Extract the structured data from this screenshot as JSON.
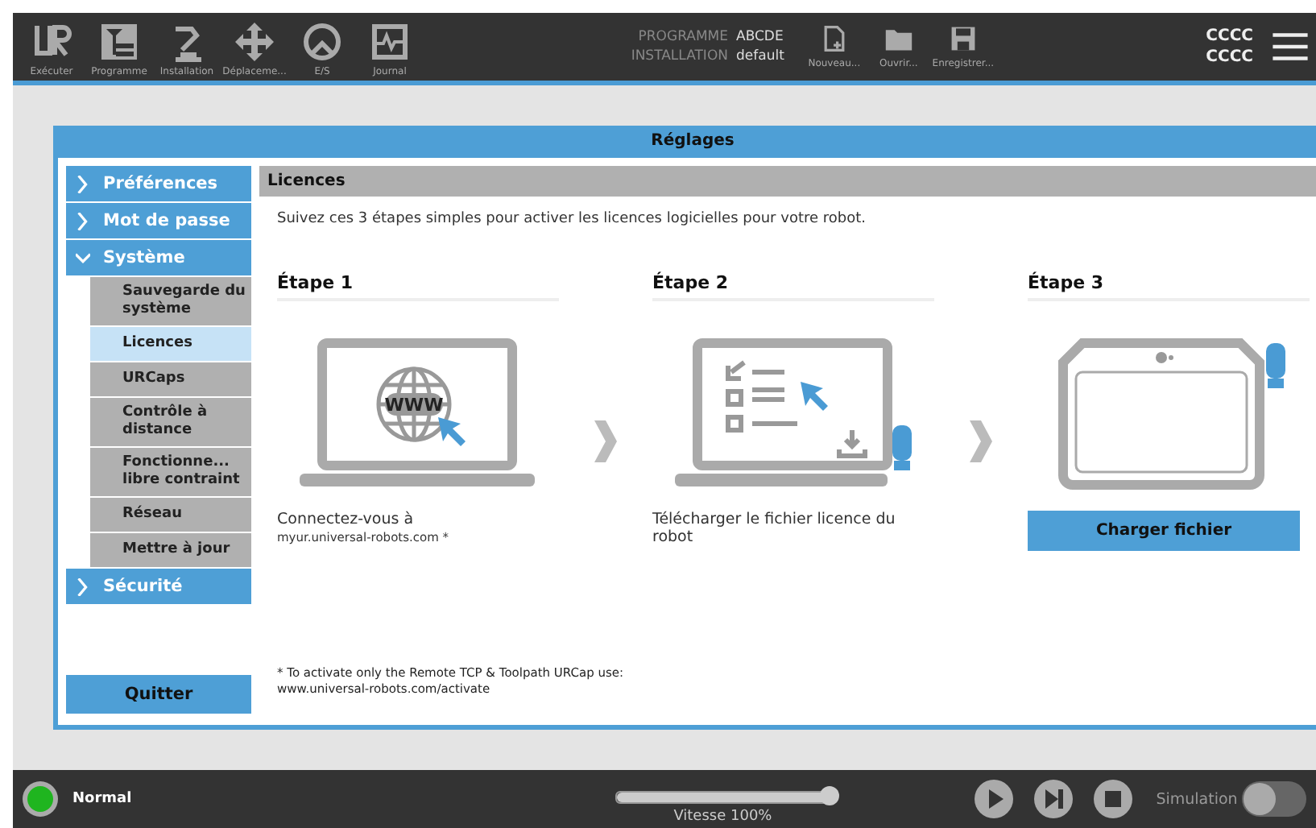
{
  "toolbar": {
    "nav": [
      {
        "label": "Exécuter"
      },
      {
        "label": "Programme"
      },
      {
        "label": "Installation"
      },
      {
        "label": "Déplaceme..."
      },
      {
        "label": "E/S"
      },
      {
        "label": "Journal"
      }
    ],
    "program": {
      "programme_label": "PROGRAMME",
      "programme_value": "ABCDE",
      "installation_label": "INSTALLATION",
      "installation_value": "default"
    },
    "file_buttons": [
      {
        "label": "Nouveau..."
      },
      {
        "label": "Ouvrir..."
      },
      {
        "label": "Enregistrer..."
      }
    ],
    "status_lines": [
      "CCCC",
      "CCCC"
    ]
  },
  "dialog": {
    "title": "Réglages",
    "sidebar": [
      {
        "label": "Préférences",
        "expanded": false
      },
      {
        "label": "Mot de passe",
        "expanded": false
      },
      {
        "label": "Système",
        "expanded": true,
        "children": [
          {
            "label": "Sauvegarde du système",
            "selected": false
          },
          {
            "label": "Licences",
            "selected": true
          },
          {
            "label": "URCaps",
            "selected": false
          },
          {
            "label": "Contrôle à distance",
            "selected": false
          },
          {
            "label": "Fonctionne... libre contraint",
            "selected": false
          },
          {
            "label": "Réseau",
            "selected": false
          },
          {
            "label": "Mettre à jour",
            "selected": false
          }
        ]
      },
      {
        "label": "Sécurité",
        "expanded": false
      }
    ],
    "quit_button": "Quitter",
    "panel": {
      "title": "Licences",
      "intro": "Suivez ces 3 étapes simples pour activer les licences logicielles pour votre robot.",
      "steps": [
        {
          "title": "Étape 1",
          "kind": "web",
          "screen_text": "WWW",
          "description": "Connectez-vous à",
          "link": "myur.universal-robots.com *"
        },
        {
          "title": "Étape 2",
          "kind": "download",
          "description": "Télécharger le fichier licence du robot"
        },
        {
          "title": "Étape 3",
          "kind": "upload",
          "button": "Charger fichier"
        }
      ],
      "footnote": [
        "* To activate only the Remote TCP & Toolpath URCap use:",
        "www.universal-robots.com/activate"
      ]
    }
  },
  "footer": {
    "status": "Normal",
    "speed": {
      "level": 1,
      "reading": "Vitesse 100%"
    },
    "simulation": {
      "label": "Simulation",
      "on": false
    }
  }
}
